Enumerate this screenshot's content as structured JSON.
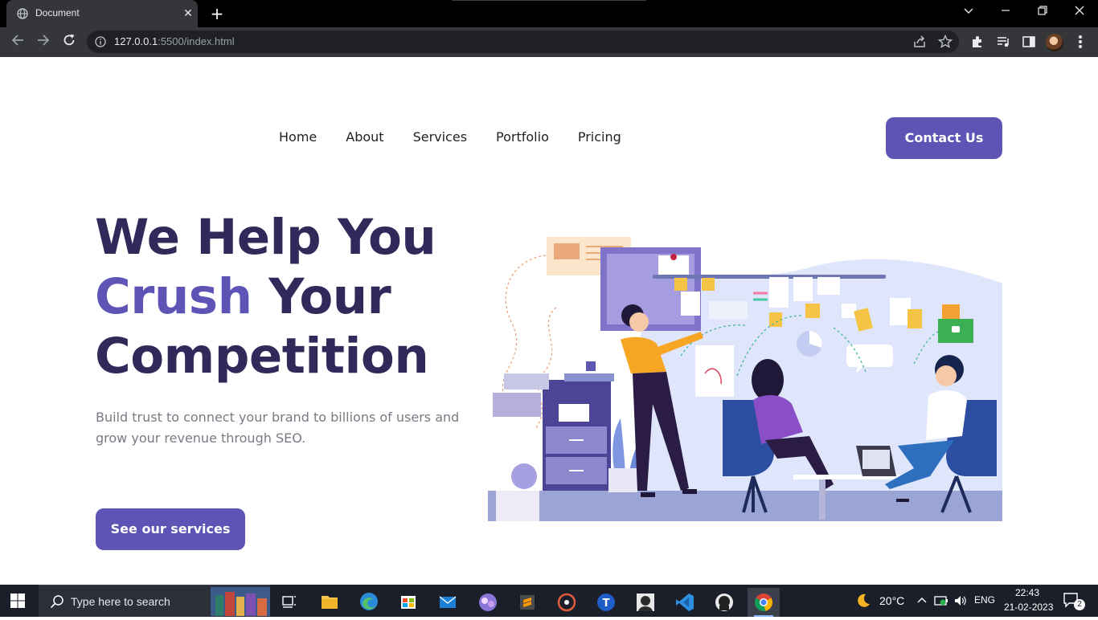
{
  "browser": {
    "tab_title": "Document",
    "url_host": "127.0.0.1",
    "url_rest": ":5500/index.html",
    "new_tab": "+",
    "close_tab": "✕"
  },
  "nav": {
    "items": [
      "Home",
      "About",
      "Services",
      "Portfolio",
      "Pricing"
    ],
    "contact_label": "Contact Us"
  },
  "hero": {
    "title_line1": "We Help You",
    "title_accent": "Crush",
    "title_line2_rest": " Your",
    "title_line3": "Competition",
    "subtitle": "Build trust to connect your brand to billions of users and grow your revenue through SEO.",
    "cta_label": "See our services"
  },
  "taskbar": {
    "search_placeholder": "Type here to search",
    "weather": "20°C",
    "language": "ENG",
    "time": "22:43",
    "date": "21-02-2023",
    "notifications": "2"
  },
  "colors": {
    "brand": "#5d54b6",
    "heading": "#33285a",
    "body_text": "#7a7a85"
  }
}
